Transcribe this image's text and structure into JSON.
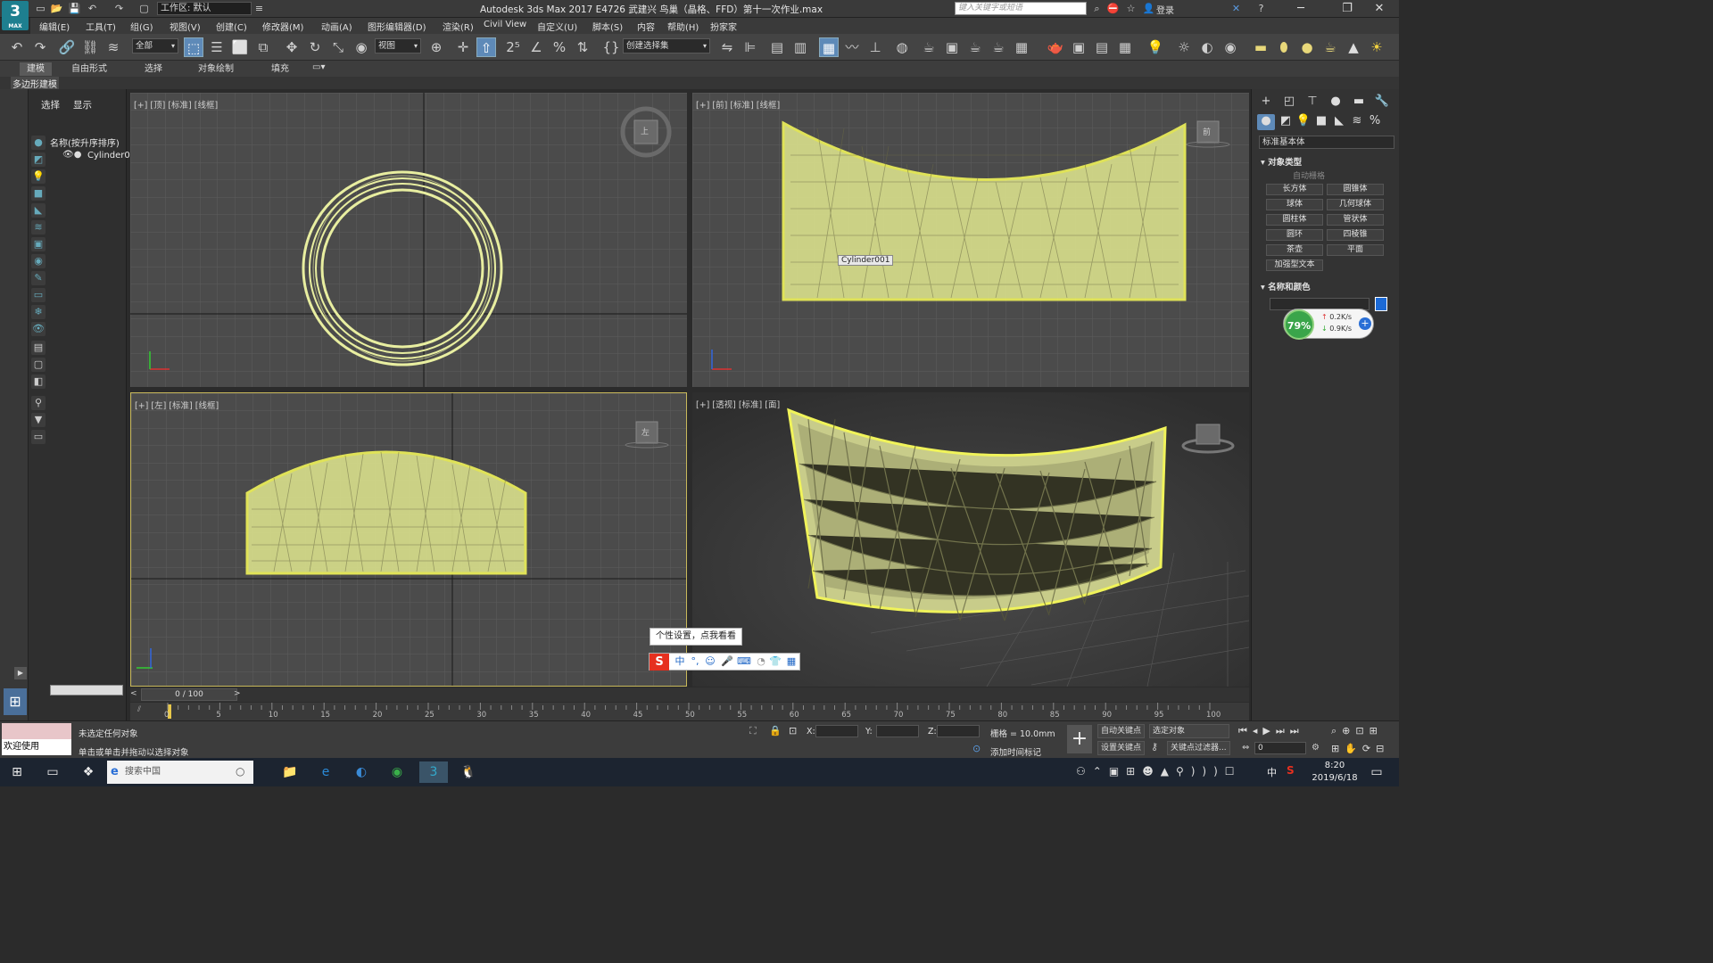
{
  "app": {
    "logo_text": "3",
    "logo_sub": "MAX",
    "workspace": "工作区: 默认",
    "title": "Autodesk 3ds Max 2017    E4726 武建兴 鸟巢（晶格、FFD）第十一次作业.max",
    "search_placeholder": "键入关键字或短语",
    "login": "登录"
  },
  "menu": [
    "编辑(E)",
    "工具(T)",
    "组(G)",
    "视图(V)",
    "创建(C)",
    "修改器(M)",
    "动画(A)",
    "图形编辑器(D)",
    "渲染(R)",
    "Civil View",
    "自定义(U)",
    "脚本(S)",
    "内容",
    "帮助(H)",
    "扮家家"
  ],
  "toolbar": {
    "selection_filter": "全部",
    "ref_coord": "视图",
    "named_selection": "创建选择集"
  },
  "ribbon": {
    "tabs": [
      "建模",
      "自由形式",
      "选择",
      "对象绘制",
      "填充"
    ],
    "active_tab": "建模",
    "sub_label": "多边形建模"
  },
  "scene_explorer": {
    "tabs": [
      "选择",
      "显示"
    ],
    "column_header": "名称(按升序排序)",
    "items": [
      "Cylinder0"
    ]
  },
  "viewports": {
    "top_left": "[+] [顶] [标准] [线框]",
    "top_right": "[+] [前] [标准] [线框]",
    "bottom_left": "[+] [左] [标准] [线框]",
    "bottom_right": "[+] [透视] [标准] [面]",
    "object_tooltip": "Cylinder001",
    "cube_top": "上",
    "cube_front": "前",
    "cube_left": "左"
  },
  "command_panel": {
    "dropdown": "标准基本体",
    "section_object_type": "对象类型",
    "auto_grid": "自动栅格",
    "buttons": [
      "长方体",
      "圆锥体",
      "球体",
      "几何球体",
      "圆柱体",
      "管状体",
      "圆环",
      "四棱锥",
      "茶壶",
      "平面",
      "加强型文本"
    ],
    "section_name_color": "名称和颜色"
  },
  "net_widget": {
    "percent": "79%",
    "up": "0.2K/s",
    "down": "0.9K/s"
  },
  "timeline": {
    "slider": "0 / 100",
    "ticks": [
      "0",
      "5",
      "10",
      "15",
      "20",
      "25",
      "30",
      "35",
      "40",
      "45",
      "50",
      "55",
      "60",
      "65",
      "70",
      "75",
      "80",
      "85",
      "90",
      "95",
      "100"
    ]
  },
  "status": {
    "welcome": "欢迎使用 MAXSc",
    "line1": "未选定任何对象",
    "line2": "单击或单击并拖动以选择对象",
    "x_label": "X:",
    "y_label": "Y:",
    "z_label": "Z:",
    "grid": "栅格 = 10.0mm",
    "add_time_tag": "添加时间标记",
    "auto_key": "自动关键点",
    "set_key": "设置关键点",
    "selected_obj": "选定对象",
    "key_filters": "关键点过滤器...",
    "frame": "0"
  },
  "ime": {
    "tip": "个性设置，点我看看",
    "logo": "S",
    "glyphs": [
      "中",
      "°,",
      "☺",
      "🎤",
      "⌨",
      "👕",
      "▦"
    ]
  },
  "taskbar": {
    "search": "搜索中国",
    "time": "8:20",
    "date": "2019/6/18",
    "ime_lang": "中"
  }
}
